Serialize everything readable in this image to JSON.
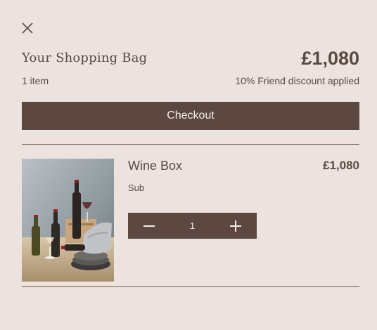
{
  "header": {
    "close_icon": "close-icon",
    "title": "Your Shopping Bag",
    "total": "£1,080",
    "item_count": "1 item",
    "discount_note": "10% Friend discount applied"
  },
  "checkout": {
    "label": "Checkout"
  },
  "cart": {
    "items": [
      {
        "name": "Wine Box",
        "subtitle": "Sub",
        "price": "£1,080",
        "quantity": "1",
        "image_alt": "Wine bottles with glasses and plates on a table"
      }
    ]
  },
  "colors": {
    "background": "#ece3de",
    "accent": "#5c4840",
    "text": "#5b4a43",
    "button_text": "#f4eeea"
  },
  "icons": {
    "decrement": "minus-icon",
    "increment": "plus-icon"
  }
}
